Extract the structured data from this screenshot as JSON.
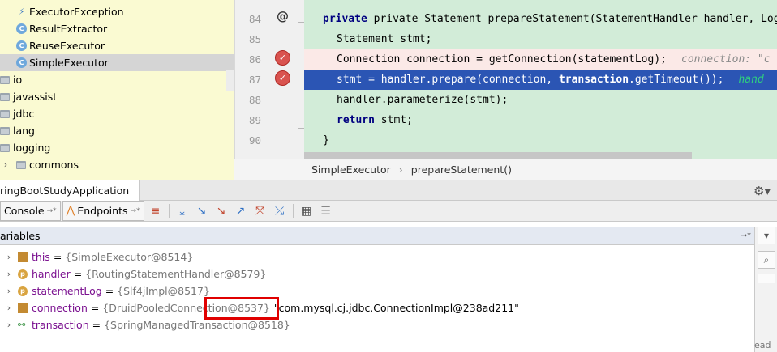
{
  "tree": {
    "rows": [
      {
        "label": "ExecutorException",
        "icon": "exception-icon"
      },
      {
        "label": "ResultExtractor",
        "icon": "class-icon"
      },
      {
        "label": "ReuseExecutor",
        "icon": "class-icon"
      },
      {
        "label": "SimpleExecutor",
        "icon": "class-icon",
        "selected": true
      },
      {
        "label": "io",
        "icon": "package-icon"
      },
      {
        "label": "javassist",
        "icon": "package-icon"
      },
      {
        "label": "jdbc",
        "icon": "package-icon"
      },
      {
        "label": "lang",
        "icon": "package-icon"
      },
      {
        "label": "logging",
        "icon": "package-icon"
      },
      {
        "label": "commons",
        "icon": "package-icon"
      }
    ]
  },
  "editor": {
    "lines": [
      {
        "num": "84",
        "text": "private Statement prepareStatement(StatementHandler handler, Log stat"
      },
      {
        "num": "85",
        "text": "Statement stmt;"
      },
      {
        "num": "86",
        "text": "Connection connection = getConnection(statementLog);",
        "hint": "connection: \"c"
      },
      {
        "num": "87",
        "text_a": "stmt = handler.prepare(connection, ",
        "text_b": "transaction",
        "text_c": ".getTimeout());",
        "hint": "hand"
      },
      {
        "num": "88",
        "text": "handler.parameterize(stmt);"
      },
      {
        "num": "89",
        "kw": "return",
        "text": " stmt;"
      },
      {
        "num": "90",
        "text": "}"
      }
    ]
  },
  "breadcrumb": {
    "class_name": "SimpleExecutor",
    "separator": "›",
    "method_name": "prepareStatement()"
  },
  "debug": {
    "title": "ringBootStudyApplication",
    "tabs": [
      {
        "label": "Console"
      },
      {
        "label": "Endpoints"
      }
    ]
  },
  "variables": {
    "header": "ariables",
    "rows": [
      {
        "name": "this",
        "value": "{SimpleExecutor@8514}",
        "icon": "field-icon"
      },
      {
        "name": "handler",
        "value": "{RoutingStatementHandler@8579}",
        "icon": "parameter-icon",
        "badge": "p"
      },
      {
        "name": "statementLog",
        "value": "{Slf4jImpl@8517}",
        "icon": "parameter-icon",
        "badge": "p"
      },
      {
        "name": "connection",
        "value": "{DruidPooledConnection@8537}",
        "string_value": "\"com.mysql.cj.jdbc.ConnectionImpl@238ad211\"",
        "icon": "field-icon"
      },
      {
        "name": "transaction",
        "value": "{SpringManagedTransaction@8518}",
        "icon": "watch-icon"
      }
    ],
    "partial_right": "ead t"
  }
}
